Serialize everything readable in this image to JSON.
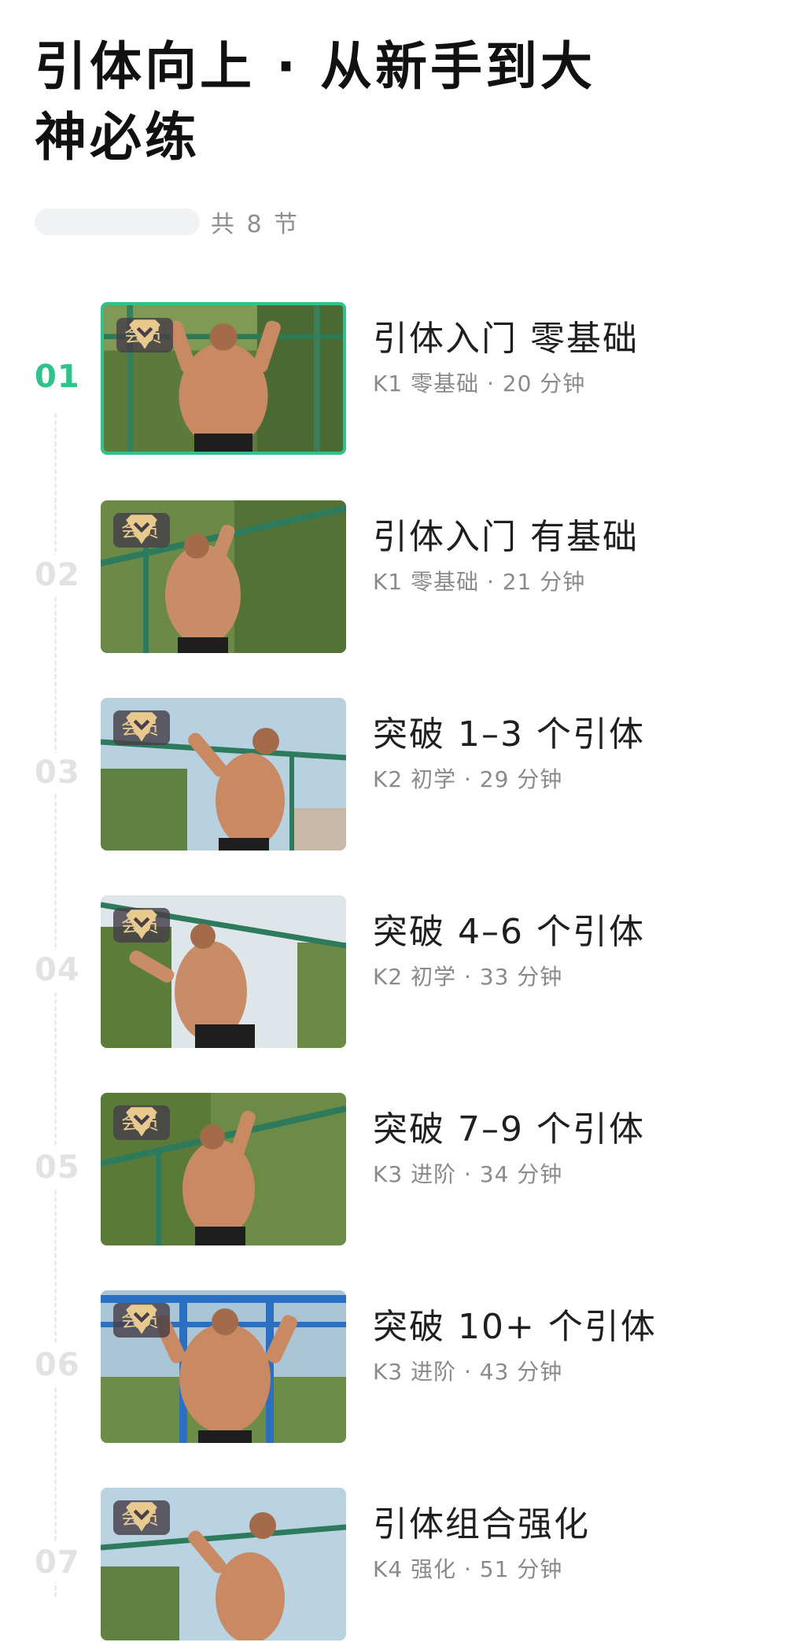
{
  "header": {
    "title": "引体向上 · 从新手到大神必练",
    "lesson_count": "共 8 节"
  },
  "member_badge": "会员",
  "lessons": [
    {
      "num": "01",
      "title": "引体入门 零基础",
      "meta": "K1 零基础 · 20 分钟",
      "active": true
    },
    {
      "num": "02",
      "title": "引体入门 有基础",
      "meta": "K1 零基础 · 21 分钟",
      "active": false
    },
    {
      "num": "03",
      "title": "突破 1–3 个引体",
      "meta": "K2 初学 · 29 分钟",
      "active": false
    },
    {
      "num": "04",
      "title": "突破 4–6 个引体",
      "meta": "K2 初学 · 33 分钟",
      "active": false
    },
    {
      "num": "05",
      "title": "突破 7–9 个引体",
      "meta": "K3 进阶 · 34 分钟",
      "active": false
    },
    {
      "num": "06",
      "title": "突破 10+ 个引体",
      "meta": "K3 进阶 · 43 分钟",
      "active": false
    },
    {
      "num": "07",
      "title": "引体组合强化",
      "meta": "K4 强化 · 51 分钟",
      "active": false
    }
  ],
  "colors": {
    "accent": "#2fc28a",
    "badge_text": "#e8c98e",
    "badge_bg": "#463e48"
  },
  "icons": {
    "badge": "diamond-icon"
  }
}
